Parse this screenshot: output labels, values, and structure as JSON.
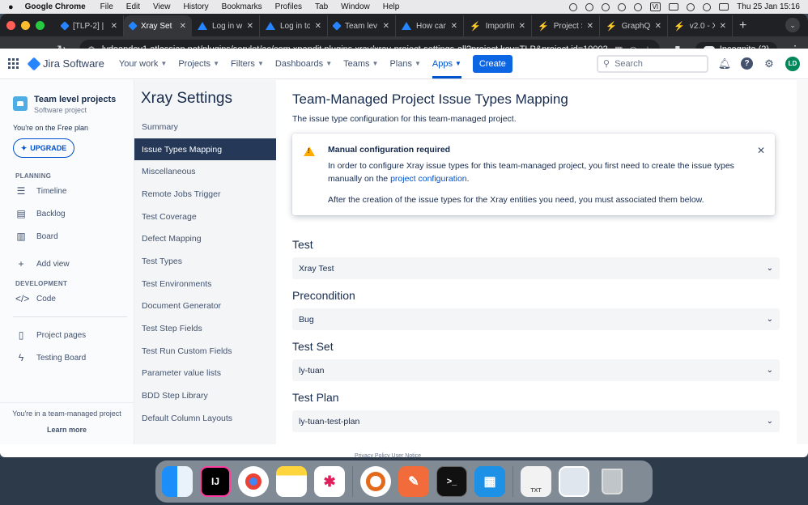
{
  "menubar": {
    "apple": "",
    "app_name": "Google Chrome",
    "items": [
      "File",
      "Edit",
      "View",
      "History",
      "Bookmarks",
      "Profiles",
      "Tab",
      "Window",
      "Help"
    ],
    "vi": "VI",
    "datetime": "Thu 25 Jan  15:16"
  },
  "browser": {
    "tabs": [
      {
        "title": "[TLP-2] |",
        "favicon": "jira-icon"
      },
      {
        "title": "Xray Set",
        "favicon": "jira-icon",
        "active": true
      },
      {
        "title": "Log in w",
        "favicon": "atlassian-icon"
      },
      {
        "title": "Log in to",
        "favicon": "atlassian-icon"
      },
      {
        "title": "Team lev",
        "favicon": "jira-icon"
      },
      {
        "title": "How can",
        "favicon": "atlassian-icon"
      },
      {
        "title": "Importin",
        "favicon": "bolt-icon"
      },
      {
        "title": "Project S",
        "favicon": "bolt-icon"
      },
      {
        "title": "GraphQL",
        "favicon": "bolt-icon"
      },
      {
        "title": "v2.0 - X",
        "favicon": "bolt-icon"
      }
    ],
    "url": "lydoandev1.atlassian.net/plugins/servlet/ac/com.xpandit.plugins.xray/xray-project-settings-all?project.key=TLP&project.id=10002",
    "incognito_label": "Incognito (2)"
  },
  "jira": {
    "product": "Jira Software",
    "nav": [
      "Your work",
      "Projects",
      "Filters",
      "Dashboards",
      "Teams",
      "Plans",
      "Apps"
    ],
    "active_nav": "Apps",
    "create_label": "Create",
    "search_placeholder": "Search",
    "avatar_initials": "LD"
  },
  "project_sidebar": {
    "project_name": "Team level projects",
    "project_type": "Software project",
    "free_plan": "You're on the Free plan",
    "upgrade_label": "UPGRADE",
    "planning_heading": "PLANNING",
    "planning_items": [
      "Timeline",
      "Backlog",
      "Board"
    ],
    "add_view": "Add view",
    "development_heading": "DEVELOPMENT",
    "development_items": [
      "Code"
    ],
    "other_items": [
      "Project pages",
      "Testing Board"
    ],
    "team_managed_text": "You're in a team-managed project",
    "learn_more": "Learn more"
  },
  "xray_sidebar": {
    "title": "Xray Settings",
    "items": [
      "Summary",
      "Issue Types Mapping",
      "Miscellaneous",
      "Remote Jobs Trigger",
      "Test Coverage",
      "Defect Mapping",
      "Test Types",
      "Test Environments",
      "Document Generator",
      "Test Step Fields",
      "Test Run Custom Fields",
      "Parameter value lists",
      "BDD Step Library",
      "Default Column Layouts"
    ],
    "active_item": "Issue Types Mapping"
  },
  "main": {
    "title": "Team-Managed Project Issue Types Mapping",
    "description": "The issue type configuration for this team-managed project.",
    "flag": {
      "title": "Manual configuration required",
      "text_before_link": "In order to configure Xray issue types for this team-managed project, you first need to create the issue types manually on the ",
      "link_text": "project configuration",
      "text_after_link": ".",
      "text2": "After the creation of the issue types for the Xray entities you need, you must associated them below."
    },
    "mappings": [
      {
        "label": "Test",
        "value": "Xray Test"
      },
      {
        "label": "Precondition",
        "value": "Bug"
      },
      {
        "label": "Test Set",
        "value": "ly-tuan"
      },
      {
        "label": "Test Plan",
        "value": "ly-tuan-test-plan"
      }
    ],
    "footer_links": "Privacy Policy   User Notice"
  },
  "dock": {
    "apps": [
      "finder-icon",
      "intellij-icon",
      "chrome-icon",
      "notes-icon",
      "slack-icon",
      "remote-desktop-icon",
      "postman-icon",
      "terminal-icon",
      "docker-icon",
      "text-file-icon",
      "screenshot-icon",
      "trash-icon"
    ],
    "intellij_label": "IJ",
    "terminal_label": ">_",
    "txt_label": "TXT"
  }
}
